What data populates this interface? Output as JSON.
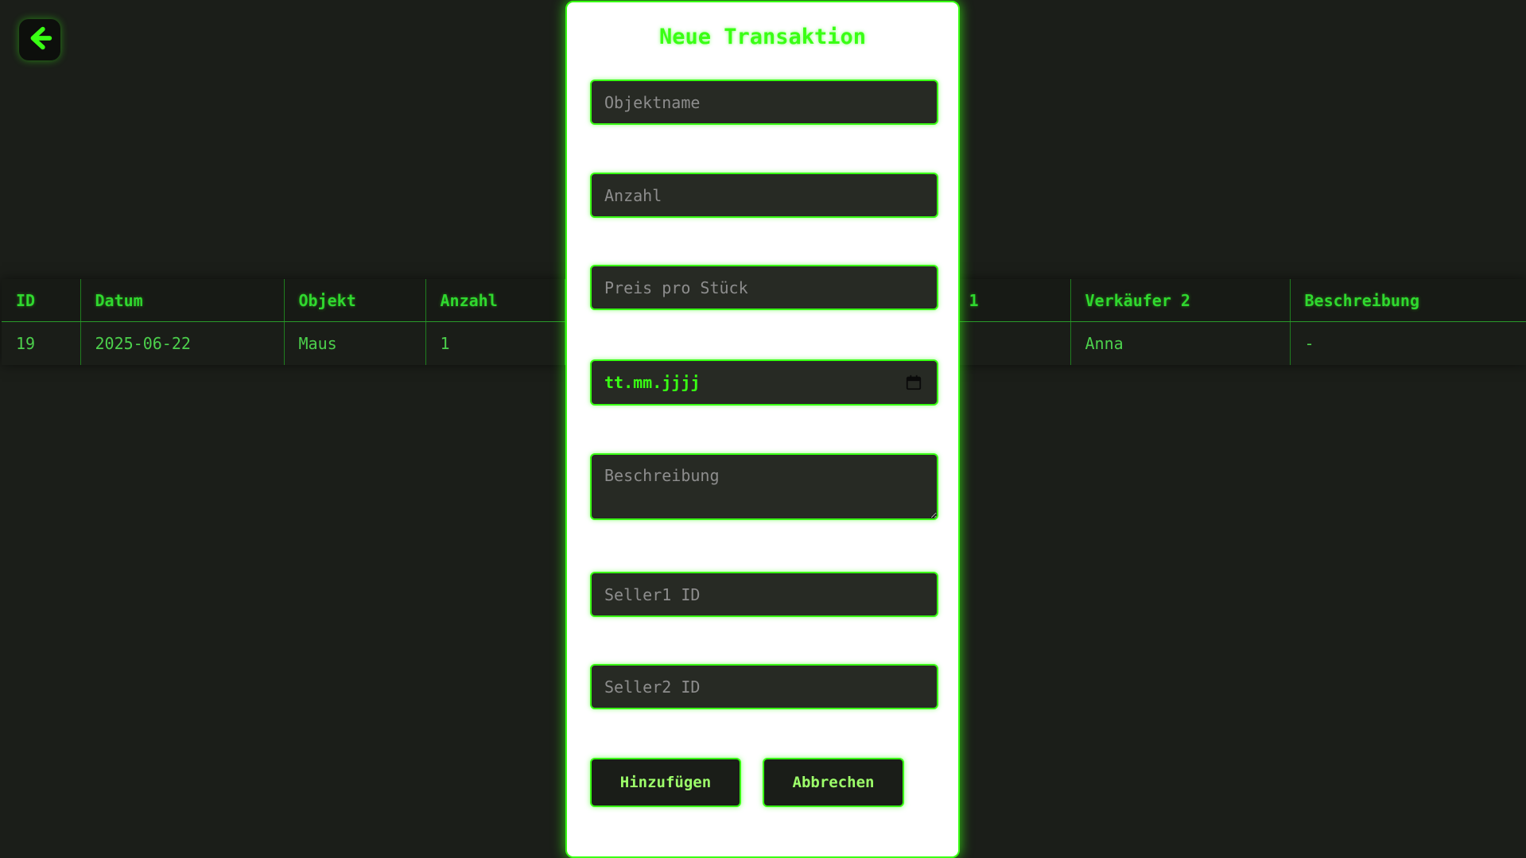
{
  "back": {
    "icon": "arrow-left-icon"
  },
  "table": {
    "headers": [
      "ID",
      "Datum",
      "Objekt",
      "Anzahl",
      "",
      "",
      "1",
      "Verkäufer 2",
      "Beschreibung"
    ],
    "rows": [
      [
        "19",
        "2025-06-22",
        "Maus",
        "1",
        "",
        "",
        "",
        "Anna",
        "-"
      ]
    ]
  },
  "modal": {
    "title": "Neue Transaktion",
    "fields": {
      "objektname_placeholder": "Objektname",
      "anzahl_placeholder": "Anzahl",
      "preis_placeholder": "Preis pro Stück",
      "date_value": "tt.mm.jjjj",
      "beschreibung_placeholder": "Beschreibung",
      "seller1_placeholder": "Seller1 ID",
      "seller2_placeholder": "Seller2 ID"
    },
    "buttons": {
      "add_label": "Hinzufügen",
      "cancel_label": "Abbrechen"
    }
  },
  "colors": {
    "accent": "#39ff14",
    "background": "#1b1e19",
    "modal_background": "#ffffff",
    "field_background": "#272a24"
  }
}
